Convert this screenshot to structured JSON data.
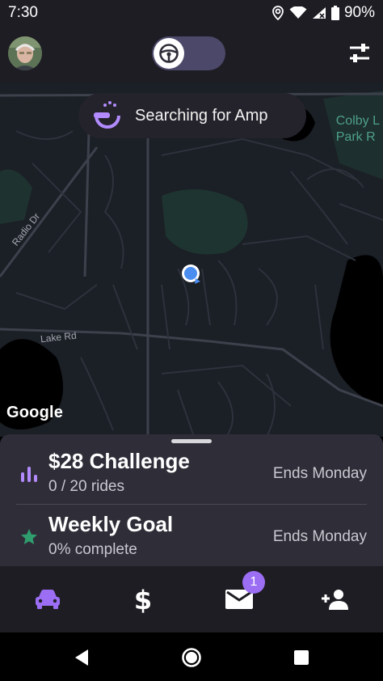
{
  "status_bar": {
    "time": "7:30",
    "battery": "90%",
    "icons": [
      "location-icon",
      "wifi-icon",
      "signal-icon",
      "battery-icon"
    ]
  },
  "header": {
    "avatar": "profile-avatar",
    "toggle_icon": "steering-wheel-icon",
    "toggle_state": "off",
    "settings_icon": "sliders-icon"
  },
  "map": {
    "search_status": "Searching for Amp",
    "park_label": "Colby L\nPark R",
    "roads": [
      "Radio Dr",
      "Lake Rd"
    ],
    "attribution": "Google"
  },
  "goals": [
    {
      "icon": "bar-chart-icon",
      "title": "$28 Challenge",
      "subtitle": "0 / 20 rides",
      "ends": "Ends Monday"
    },
    {
      "icon": "star-icon",
      "title": "Weekly Goal",
      "subtitle": "0% complete",
      "ends": "Ends Monday"
    }
  ],
  "bottom_nav": {
    "items": [
      "car-icon",
      "dollar-icon",
      "mail-icon",
      "add-person-icon"
    ],
    "mail_badge": "1",
    "active": "car-icon"
  },
  "colors": {
    "accent": "#9b6ef3",
    "goal_star": "#2f9e6e",
    "background": "#1e1d24",
    "sheet": "#2f2d38"
  }
}
